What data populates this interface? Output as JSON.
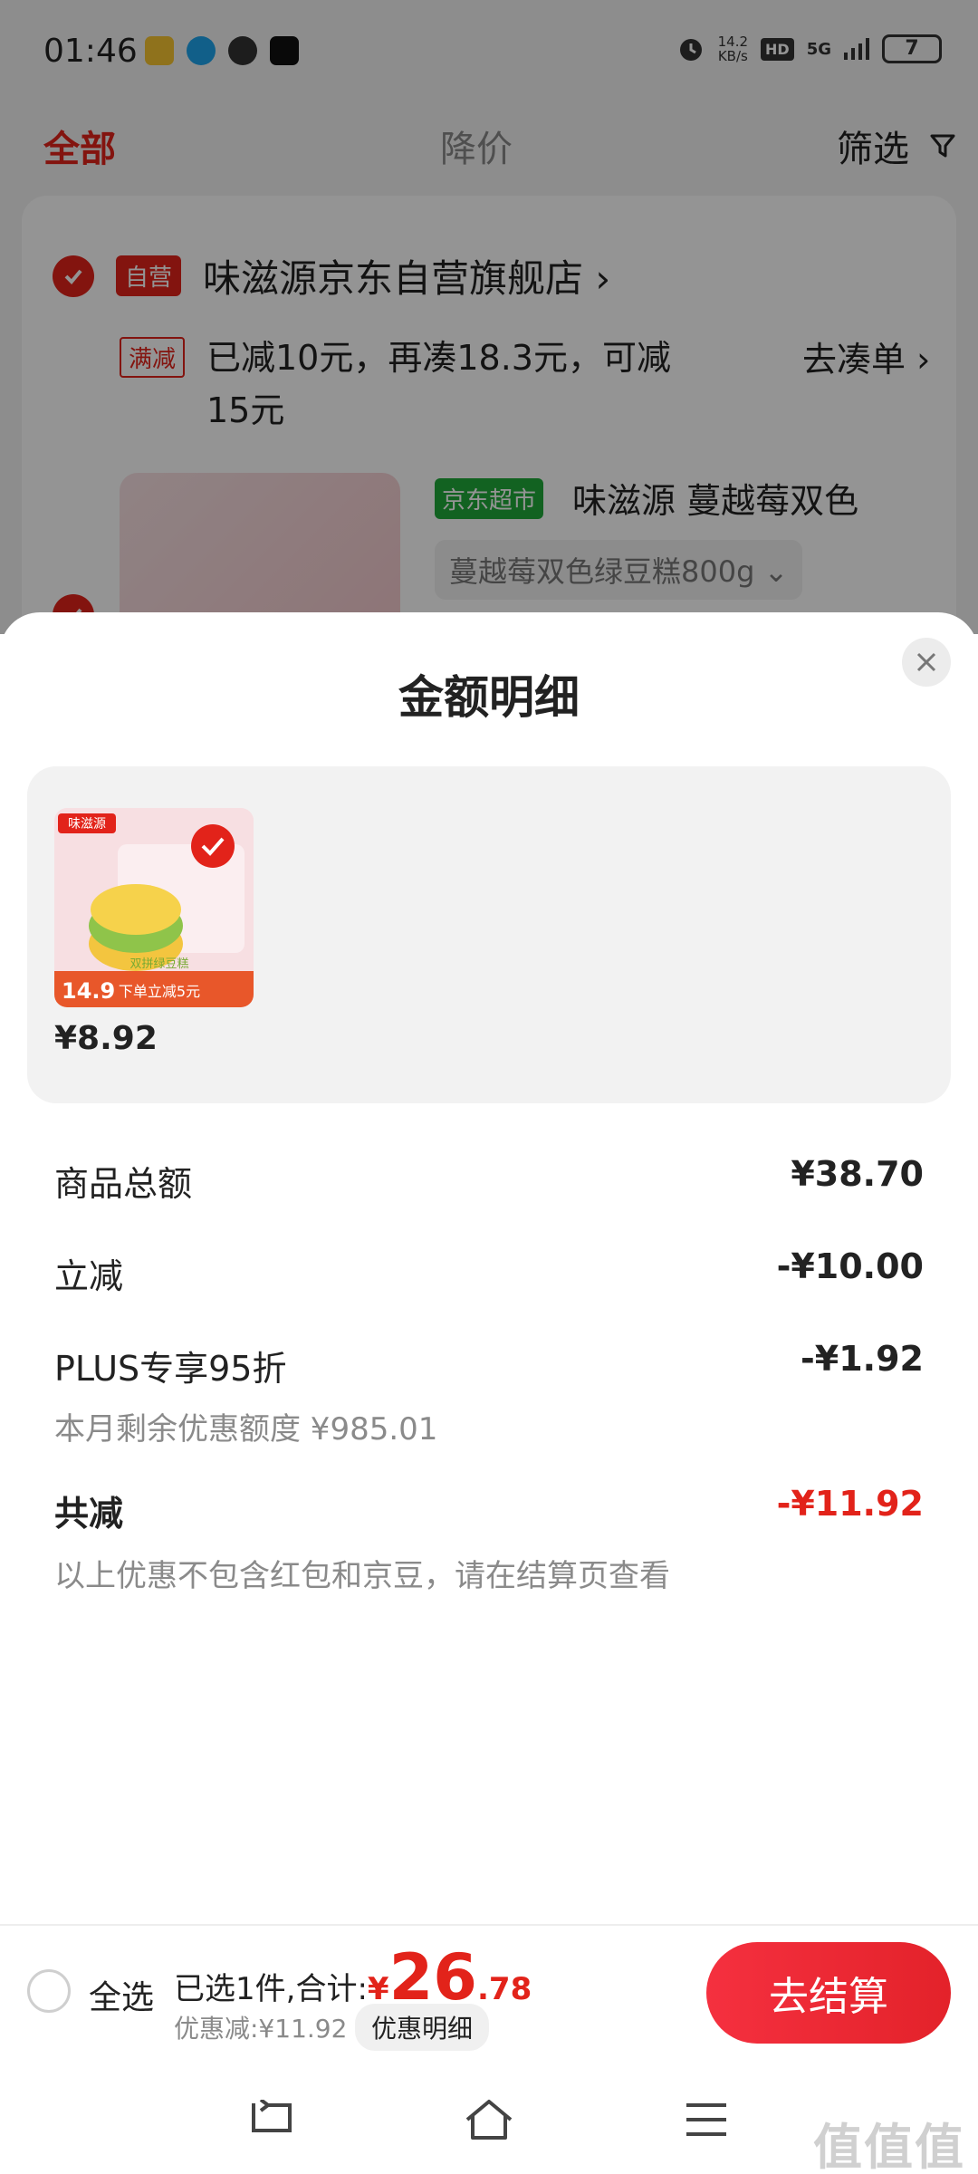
{
  "status_bar": {
    "time": "01:46",
    "net_speed_value": "14.2",
    "net_speed_unit": "KB/s",
    "hd": "HD",
    "signal": "5G",
    "battery": "7"
  },
  "tabs": {
    "all": "全部",
    "price_drop": "降价",
    "filter": "筛选"
  },
  "shop": {
    "tag": "自营",
    "name": "味滋源京东自营旗舰店 ›",
    "promo_tag": "满减",
    "promo_text": "已减10元，再凑18.3元，可减15元",
    "promo_link": "去凑单 ›",
    "product_tag": "京东超市",
    "product_title": "味滋源 蔓越莓双色",
    "product_spec": "蔓越莓双色绿豆糕800g ⌄"
  },
  "sheet": {
    "title": "金额明细",
    "item_price": "¥8.92",
    "rows": {
      "goods_total_label": "商品总额",
      "goods_total_value": "¥38.70",
      "instant_label": "立减",
      "instant_value": "-¥10.00",
      "plus_label": "PLUS专享95折",
      "plus_value": "-¥1.92",
      "plus_sub": "本月剩余优惠额度 ¥985.01",
      "total_label": "共减",
      "total_value": "-¥11.92",
      "total_sub": "以上优惠不包含红包和京豆，请在结算页查看"
    }
  },
  "checkout": {
    "select_all": "全选",
    "summary_prefix": "已选1件,合计:",
    "currency": "¥",
    "total_int": "26",
    "total_dec": ".78",
    "discount": "优惠减:¥11.92",
    "detail_button": "优惠明细",
    "pay_button": "去结算"
  },
  "thumbnail": {
    "brand": "味滋源",
    "badge_price": "14.9",
    "badge_text": "下单立减5元",
    "label": "双拼绿豆糕"
  },
  "watermark": "值值值"
}
